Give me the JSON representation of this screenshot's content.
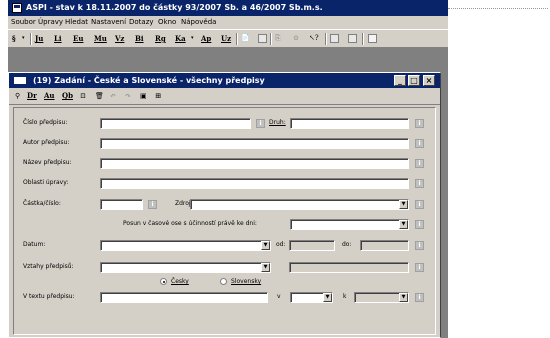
{
  "window": {
    "title": "ASPI - stav k 18.11.2007 do částky 93/2007 Sb. a 46/2007 Sb.m.s."
  },
  "menu": [
    "Soubor",
    "Úpravy",
    "Hledat",
    "Nastavení",
    "Dotazy",
    "Okno",
    "Nápověda"
  ],
  "toolbar": [
    "§",
    "Ju",
    "Li",
    "Eu",
    "Mu",
    "Vz",
    "Bi",
    "Rg",
    "Ka",
    "Ap",
    "Uz"
  ],
  "child": {
    "title": "(19) Zadání - České a Slovenské - všechny předpisy",
    "tools": [
      "Dr",
      "Au",
      "Qb"
    ]
  },
  "form": {
    "cislo_label": "Číslo předpisu:",
    "druh_label": "Druh:",
    "autor_label": "Autor předpisu:",
    "nazev_label": "Název předpisu:",
    "oblasti_label": "Oblasti úpravy:",
    "castka_label": "Částka/číslo:",
    "zdroj_label": "Zdroj:",
    "posun_label": "Posun v časové ose s účinností právě ke dni:",
    "datum_label": "Datum:",
    "od_label": "od:",
    "do_label": "do:",
    "vztahy_label": "Vztahy předpisů:",
    "radio_cesky": "Česky",
    "radio_slovensky": "Slovensky",
    "v_textu_label": "V textu předpisu:",
    "v_label": "v",
    "k_label": "k"
  }
}
